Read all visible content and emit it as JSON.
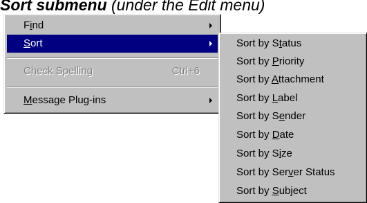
{
  "caption": {
    "bold_part": "Sort submenu",
    "rest": " (under the Edit menu)"
  },
  "main_menu": {
    "items": [
      {
        "pre": "F",
        "mnemonic": "i",
        "post": "nd",
        "has_submenu": true,
        "state": "normal"
      },
      {
        "pre": "",
        "mnemonic": "S",
        "post": "ort",
        "has_submenu": true,
        "state": "selected"
      },
      {
        "pre": "C",
        "mnemonic": "h",
        "post": "eck Spelling",
        "accelerator": "Ctrl+6",
        "state": "disabled"
      },
      {
        "pre": "",
        "mnemonic": "M",
        "post": "essage Plug-ins",
        "has_submenu": true,
        "state": "normal"
      }
    ]
  },
  "sort_submenu": {
    "items": [
      {
        "pre": "Sort by S",
        "mnemonic": "t",
        "post": "atus"
      },
      {
        "pre": "Sort by ",
        "mnemonic": "P",
        "post": "riority"
      },
      {
        "pre": "Sort by ",
        "mnemonic": "A",
        "post": "ttachment"
      },
      {
        "pre": "Sort by ",
        "mnemonic": "L",
        "post": "abel"
      },
      {
        "pre": "Sort by S",
        "mnemonic": "e",
        "post": "nder"
      },
      {
        "pre": "Sort by ",
        "mnemonic": "D",
        "post": "ate"
      },
      {
        "pre": "Sort by S",
        "mnemonic": "i",
        "post": "ze"
      },
      {
        "pre": "Sort by Ser",
        "mnemonic": "v",
        "post": "er Status"
      },
      {
        "pre": "Sort by ",
        "mnemonic": "S",
        "post": "ubject"
      }
    ]
  },
  "colors": {
    "menu_face": "#c0c0c0",
    "highlight": "#000080",
    "disabled_text": "#808080"
  },
  "icons": {
    "submenu_arrow": "submenu-arrow-icon"
  }
}
